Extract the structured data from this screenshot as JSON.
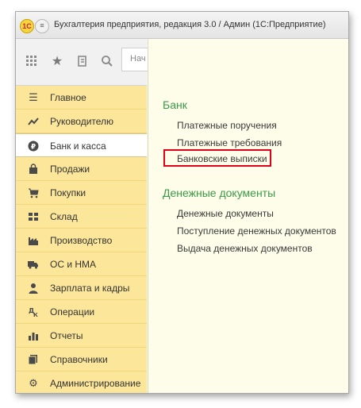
{
  "window": {
    "title": "Бухгалтерия предприятия, редакция 3.0 / Админ  (1С:Предприятие)",
    "logo_text": "1С",
    "menu_glyph": "≡"
  },
  "toolbar": {
    "buttons": [
      "grid-icon",
      "star-icon",
      "history-icon",
      "search-icon"
    ],
    "tab_stub": "Нач"
  },
  "sidebar": {
    "items": [
      {
        "label": "Главное",
        "icon": "menu-lines-icon"
      },
      {
        "label": "Руководителю",
        "icon": "trend-icon"
      },
      {
        "label": "Банк и касса",
        "icon": "coin-icon",
        "active": true
      },
      {
        "label": "Продажи",
        "icon": "bag-icon"
      },
      {
        "label": "Покупки",
        "icon": "cart-icon"
      },
      {
        "label": "Склад",
        "icon": "warehouse-icon"
      },
      {
        "label": "Производство",
        "icon": "factory-icon"
      },
      {
        "label": "ОС и НМА",
        "icon": "truck-icon"
      },
      {
        "label": "Зарплата и кадры",
        "icon": "person-icon"
      },
      {
        "label": "Операции",
        "icon": "operations-icon"
      },
      {
        "label": "Отчеты",
        "icon": "bar-chart-icon"
      },
      {
        "label": "Справочники",
        "icon": "books-icon"
      },
      {
        "label": "Администрирование",
        "icon": "gear-icon"
      }
    ]
  },
  "content": {
    "sections": [
      {
        "title": "Банк",
        "links": [
          "Платежные поручения",
          "Платежные требования",
          "Банковские выписки"
        ]
      },
      {
        "title": "Денежные документы",
        "links": [
          "Денежные документы",
          "Поступление денежных документов",
          "Выдача денежных документов"
        ]
      }
    ],
    "highlighted_link": "Банковские выписки",
    "highlight_color": "#e0001a",
    "section_title_color": "#3b9b48",
    "sidebar_color": "#fbe69a"
  }
}
